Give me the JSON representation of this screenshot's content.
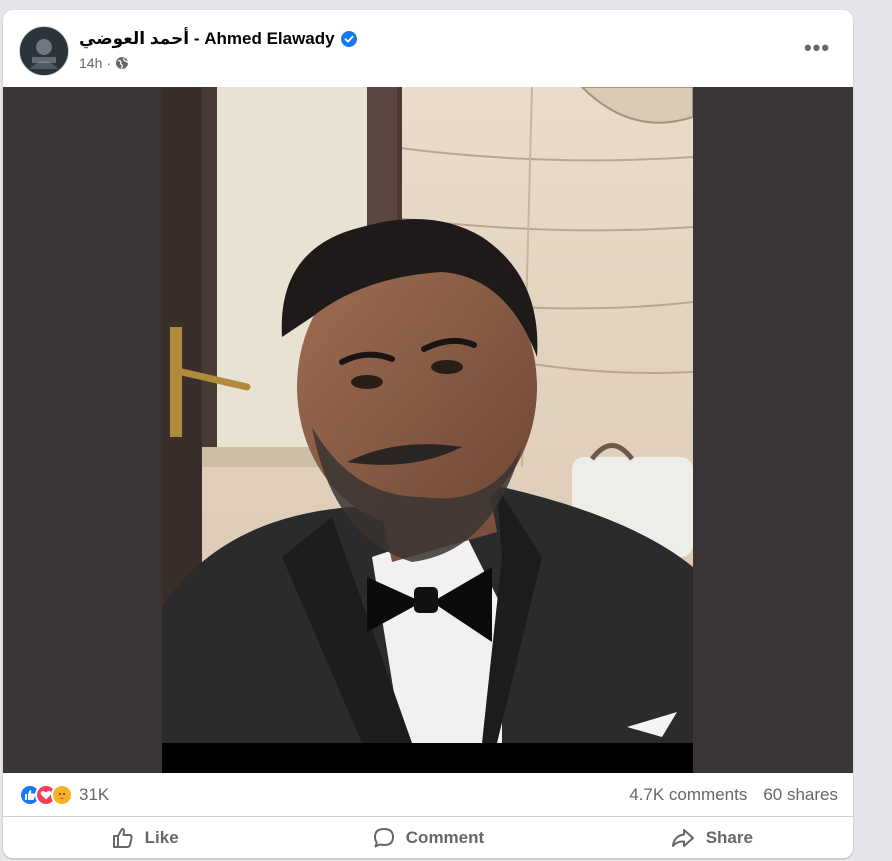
{
  "post": {
    "author_name": "أحمد العوضي - Ahmed Elawady",
    "timestamp": "14h",
    "separator": "·",
    "audience_icon": "globe-icon",
    "verified_icon": "verified-badge-icon",
    "more_label": "•••"
  },
  "stats": {
    "reaction_icons": [
      "like-reaction-icon",
      "love-reaction-icon",
      "care-reaction-icon"
    ],
    "reaction_count": "31K",
    "comments": "4.7K comments",
    "shares": "60 shares"
  },
  "actions": {
    "like": "Like",
    "comment": "Comment",
    "share": "Share"
  },
  "colors": {
    "brand_blue": "#1877f2",
    "love_red": "#f33e58",
    "care_yellow": "#f7b125",
    "secondary_text": "#65676b"
  }
}
